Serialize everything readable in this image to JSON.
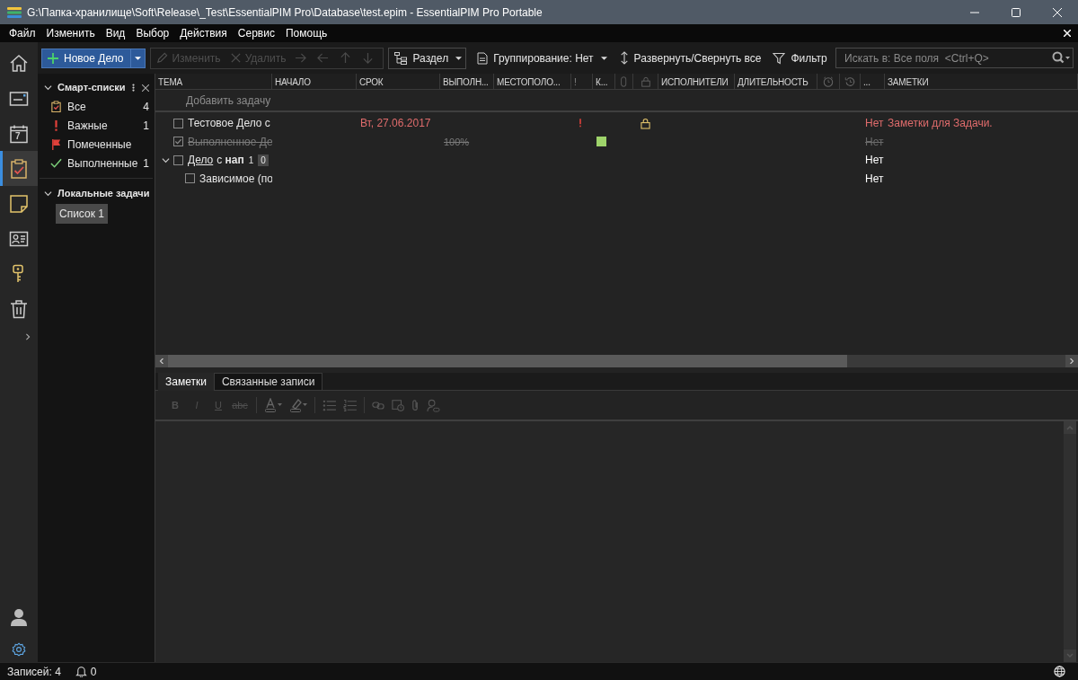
{
  "window": {
    "title": "G:\\Папка-хранилище\\Soft\\Release\\_Test\\EssentialPIM Pro\\Database\\test.epim - EssentialPIM Pro Portable"
  },
  "menu": [
    "Файл",
    "Изменить",
    "Вид",
    "Выбор",
    "Действия",
    "Сервис",
    "Помощь"
  ],
  "toolbar": {
    "new_button": "Новое Дело",
    "edit_button": {
      "label": "Изменить",
      "disabled": true
    },
    "delete_button": {
      "label": "Удалить",
      "disabled": true
    },
    "section_button": "Раздел",
    "grouping": "Группирование: Нет",
    "expand_collapse": "Развернуть/Свернуть все",
    "filter": "Фильтр",
    "search": {
      "placeholder": "Искать в: Все поля  <Ctrl+Q>"
    }
  },
  "rail": [
    {
      "selected": false
    },
    {
      "selected": false
    },
    {
      "selected": false,
      "label": "7"
    },
    {
      "selected": true
    },
    {
      "selected": false
    },
    {
      "selected": false
    },
    {
      "selected": false
    },
    {
      "selected": false
    }
  ],
  "sidebar": {
    "smart_lists": {
      "title": "Смарт-списки",
      "expanded": true,
      "items": [
        {
          "kind": "all",
          "label": "Все",
          "count": "4"
        },
        {
          "kind": "important",
          "label": "Важные",
          "count": "1"
        },
        {
          "kind": "flagged",
          "label": "Помеченные"
        },
        {
          "kind": "done",
          "label": "Выполненные",
          "count": "1"
        }
      ]
    },
    "local": {
      "title": "Локальные задачи",
      "expanded": true,
      "items": [
        {
          "label": "Список 1",
          "selected": true
        }
      ]
    }
  },
  "table": {
    "columns": [
      {
        "kind": "text",
        "label": "ТЕМА"
      },
      {
        "kind": "text",
        "label": "НАЧАЛО"
      },
      {
        "kind": "text",
        "label": "СРОК"
      },
      {
        "kind": "text",
        "label": "ВЫПОЛН..."
      },
      {
        "kind": "text",
        "label": "МЕСТОПОЛО..."
      },
      {
        "kind": "text",
        "label": "!"
      },
      {
        "kind": "text",
        "label": "К..."
      },
      {
        "kind": "icon"
      },
      {
        "kind": "icon"
      },
      {
        "kind": "text",
        "label": "ИСПОЛНИТЕЛИ"
      },
      {
        "kind": "text",
        "label": "ДЛИТЕЛЬНОСТЬ"
      },
      {
        "kind": "icon"
      },
      {
        "kind": "icon"
      },
      {
        "kind": "text",
        "label": "..."
      },
      {
        "kind": "text",
        "label": "ЗАМЕТКИ"
      }
    ],
    "add_task": "Добавить задачу",
    "rows": [
      {
        "title": "Тестовое Дело с",
        "checked": false,
        "done": false,
        "overdue": true,
        "priority": true,
        "locked": true,
        "due": "Вт, 27.06.2017",
        "recurrence": "Нет",
        "notes": "Заметки для Задачи."
      },
      {
        "title": "Выполненное Де",
        "checked": true,
        "done": true,
        "overdue": false,
        "priority": false,
        "locked": false,
        "complete": "100%",
        "color": "#9ed36a",
        "recurrence": "Нет"
      },
      {
        "link_text": "Дело",
        "title": "с **нап**",
        "checked": false,
        "done": false,
        "overdue": false,
        "priority": false,
        "locked": false,
        "expanded": true,
        "counts": [
          "1",
          "0"
        ],
        "recurrence": "Нет",
        "children": [
          {
            "title": "Зависимое (по",
            "checked": false,
            "done": false,
            "overdue": false,
            "priority": false,
            "locked": false,
            "recurrence": "Нет"
          }
        ]
      }
    ]
  },
  "bottom_tabs": [
    {
      "label": "Заметки",
      "selected": true
    },
    {
      "label": "Связанные записи",
      "selected": false
    }
  ],
  "format_buttons": [
    {
      "label": "B",
      "disabled": true
    },
    {
      "label": "I",
      "disabled": true
    },
    {
      "label": "U",
      "disabled": true
    },
    {
      "label": "abc",
      "disabled": true
    }
  ],
  "status_bar": {
    "records": "Записей: 4",
    "reminders": "0"
  }
}
